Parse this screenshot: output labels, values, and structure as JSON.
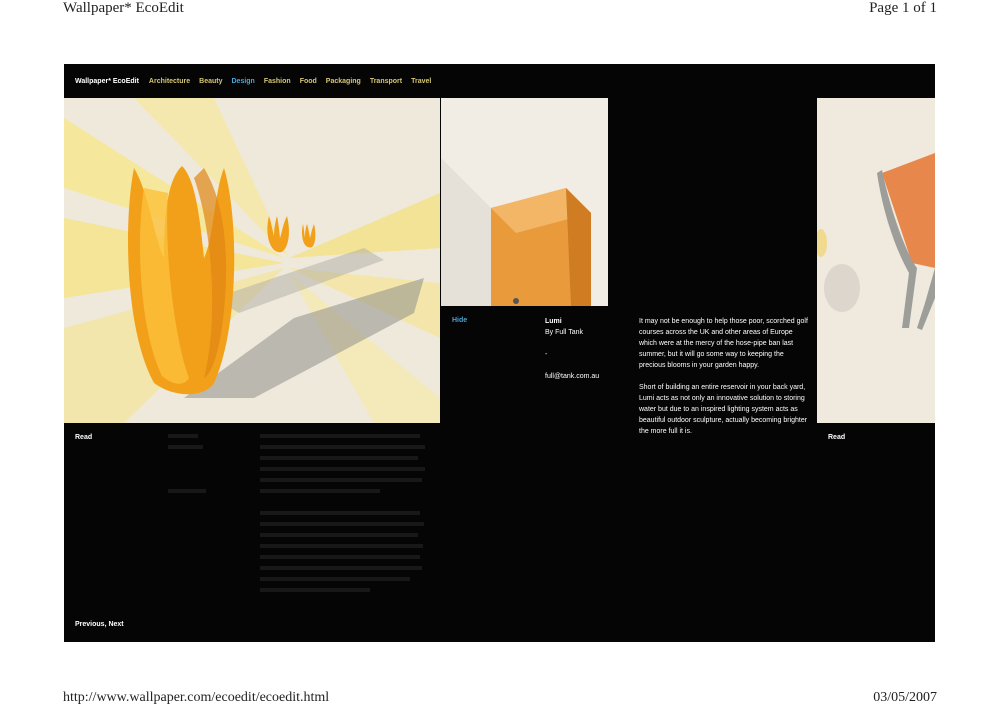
{
  "pdf": {
    "header_title": "Wallpaper* EcoEdit",
    "page_label": "Page 1 of 1",
    "url": "http://www.wallpaper.com/ecoedit/ecoedit.html",
    "date": "03/05/2007"
  },
  "nav": {
    "brand": "Wallpaper* EcoEdit",
    "items": [
      {
        "label": "Architecture"
      },
      {
        "label": "Beauty"
      },
      {
        "label": "Design",
        "active": true
      },
      {
        "label": "Fashion"
      },
      {
        "label": "Food"
      },
      {
        "label": "Packaging"
      },
      {
        "label": "Transport"
      },
      {
        "label": "Travel"
      }
    ],
    "active_color": "#49a7d8",
    "item_color": "#d7c772"
  },
  "panel": {
    "hide_label": "Hide",
    "title": "Lumi",
    "subtitle": "By Full Tank",
    "separator": "-",
    "contact": "full@tank.com.au",
    "para1": "It may not be enough to help those poor, scorched golf courses across the UK and other areas of Europe which were at the mercy of the hose-pipe ban last summer, but it will go some way to keeping the precious blooms in your garden happy.",
    "para2": "Short of building an entire reservoir in your back yard, Lumi acts as not only an innovative solution to storing water but due to an inspired lighting system acts as beautiful outdoor sculpture, actually becoming brighter the more full it is."
  },
  "read_label": "Read",
  "read_label_right": "Read",
  "pager": "Previous, Next"
}
